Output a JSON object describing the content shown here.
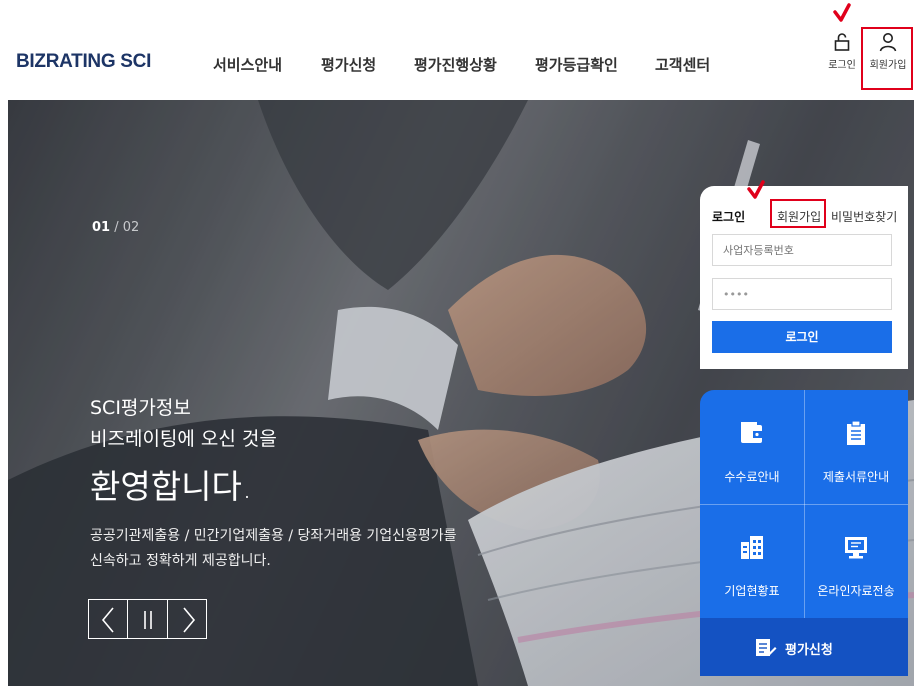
{
  "header": {
    "logo": "BIZRATING SCI",
    "nav": [
      "서비스안내",
      "평가신청",
      "평가진행상황",
      "평가등급확인",
      "고객센터"
    ],
    "login_label": "로그인",
    "signup_label": "회원가입"
  },
  "hero": {
    "slide_current": "01",
    "slide_separator": "/",
    "slide_total": "02",
    "line1": "SCI평가정보",
    "line2": "비즈레이팅에 오신 것을",
    "line3": "환영합니다.",
    "sub1": "공공기관제출용 / 민간기업제출용 / 당좌거래용 기업신용평가를",
    "sub2": "신속하고 정확하게 제공합니다."
  },
  "login_panel": {
    "tab_login": "로그인",
    "tab_signup": "회원가입",
    "tab_find_password": "비밀번호찾기",
    "business_number_placeholder": "사업자등록번호",
    "password_value": "••••",
    "submit_label": "로그인"
  },
  "quick_menu": {
    "fee": "수수료안내",
    "documents": "제출서류안내",
    "company_status": "기업현황표",
    "online_transfer": "온라인자료전송",
    "apply": "평가신청"
  },
  "colors": {
    "brand_navy": "#1d3566",
    "accent_blue": "#1a6ee8",
    "accent_dark_blue": "#1452c2",
    "annotation_red": "#e0001b"
  },
  "icons": [
    "lock-icon",
    "person-icon",
    "wallet-icon",
    "clipboard-icon",
    "building-icon",
    "monitor-icon",
    "apply-form-icon",
    "prev-arrow-icon",
    "pause-icon",
    "next-arrow-icon",
    "check-mark-icon"
  ]
}
